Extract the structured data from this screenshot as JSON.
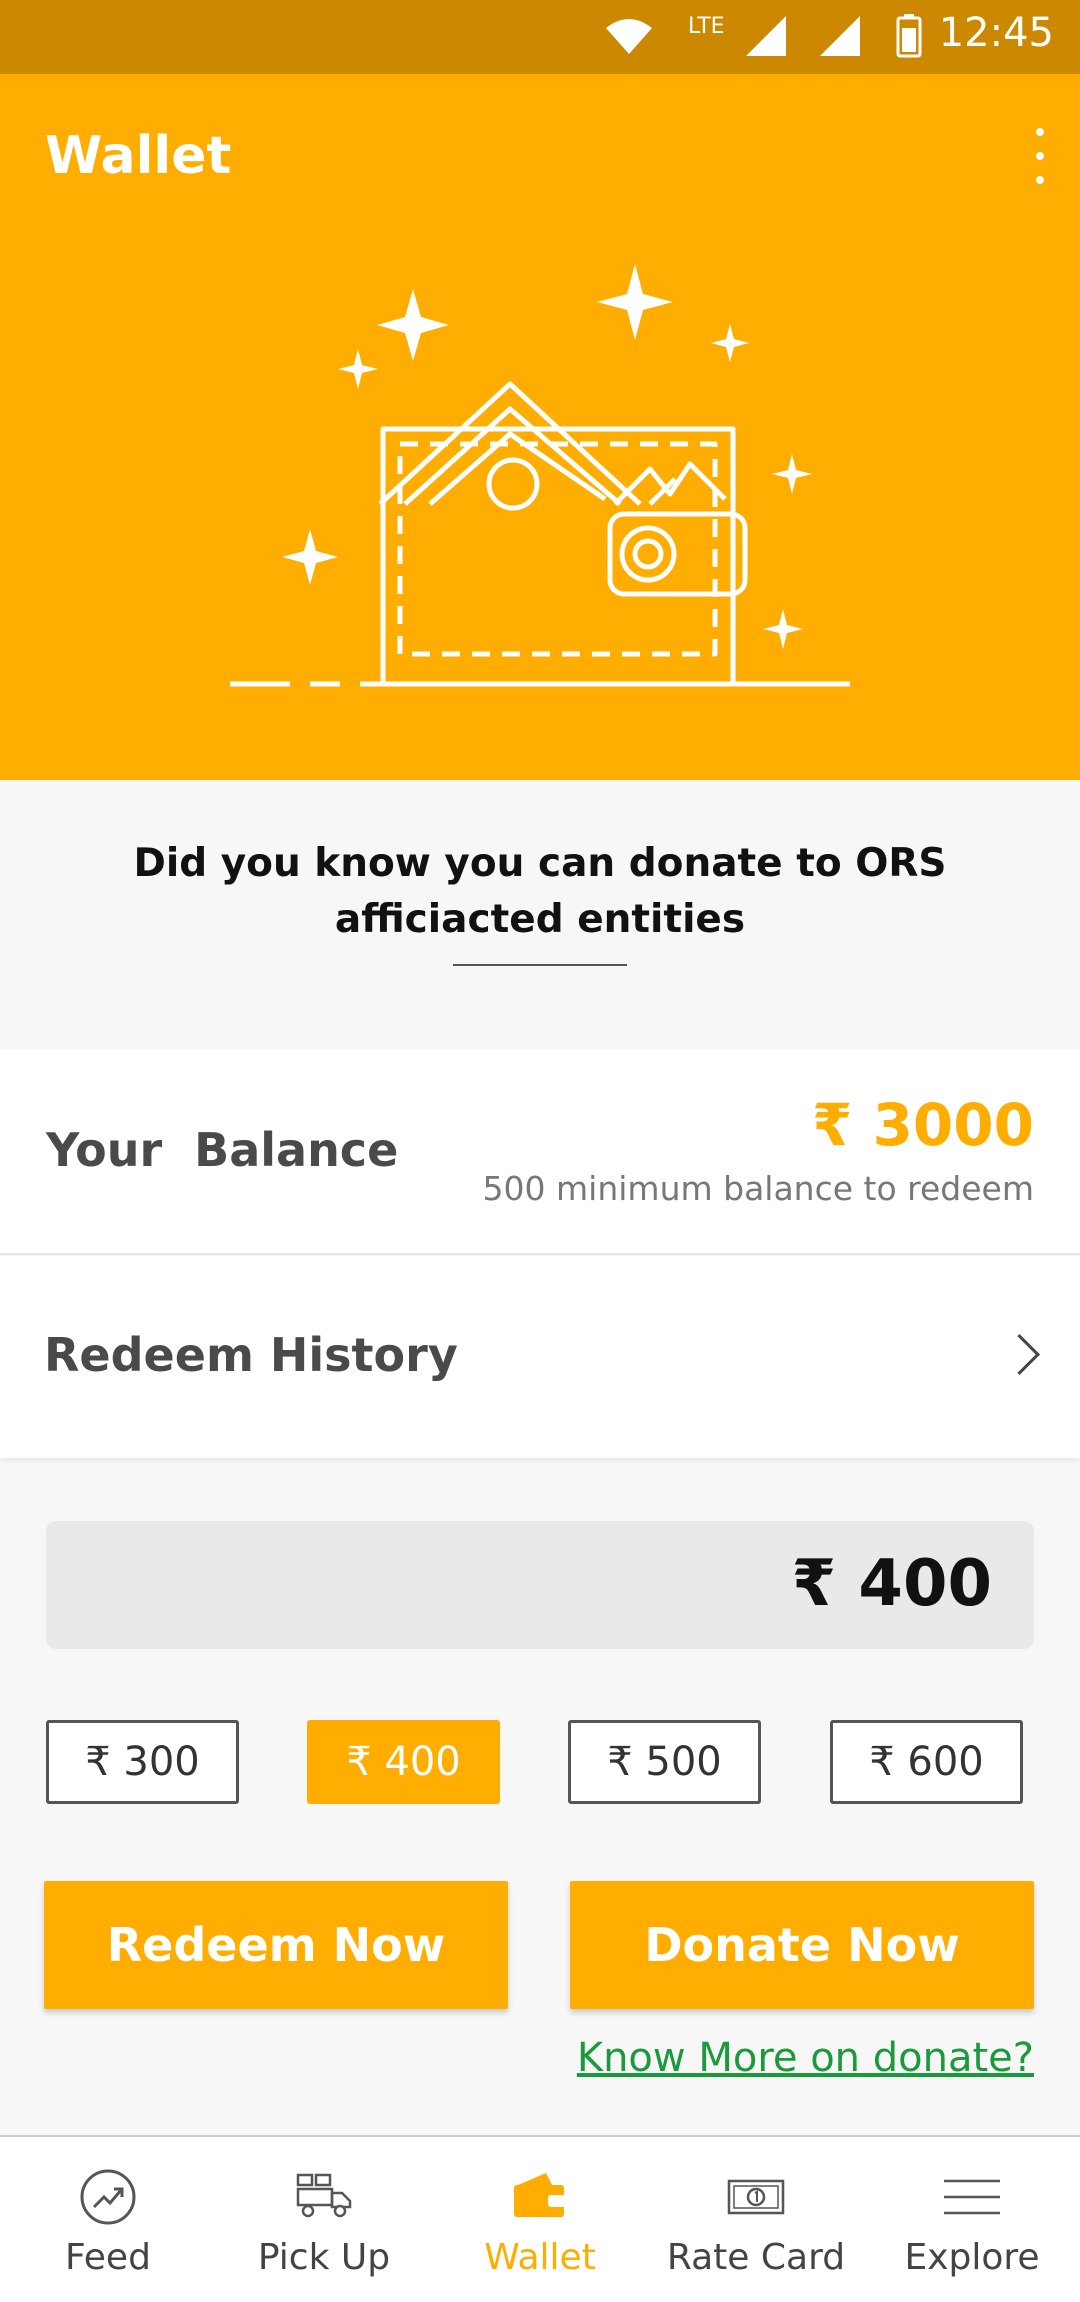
{
  "status_bar": {
    "time": "12:45",
    "network": "LTE"
  },
  "header": {
    "title": "Wallet"
  },
  "tip": {
    "line1": "Did you know you can donate to ORS",
    "line2": "afficiacted entities"
  },
  "balance": {
    "label": "Your  Balance",
    "amount": "₹ 3000",
    "note": "500 minimum balance to redeem"
  },
  "history": {
    "label": "Redeem History"
  },
  "amount_input": {
    "value": "₹ 400"
  },
  "amount_options": [
    "₹ 300",
    "₹ 400",
    "₹ 500",
    "₹ 600"
  ],
  "selected_option": "₹ 400",
  "actions": {
    "redeem": "Redeem Now",
    "donate": "Donate Now",
    "know_more": "Know More on donate?"
  },
  "nav": [
    "Feed",
    "Pick Up",
    "Wallet",
    "Rate Card",
    "Explore"
  ],
  "active_nav": "Wallet",
  "colors": {
    "accent": "#ffad00",
    "status_bar": "#cc8800",
    "link": "#1a9a3a"
  }
}
